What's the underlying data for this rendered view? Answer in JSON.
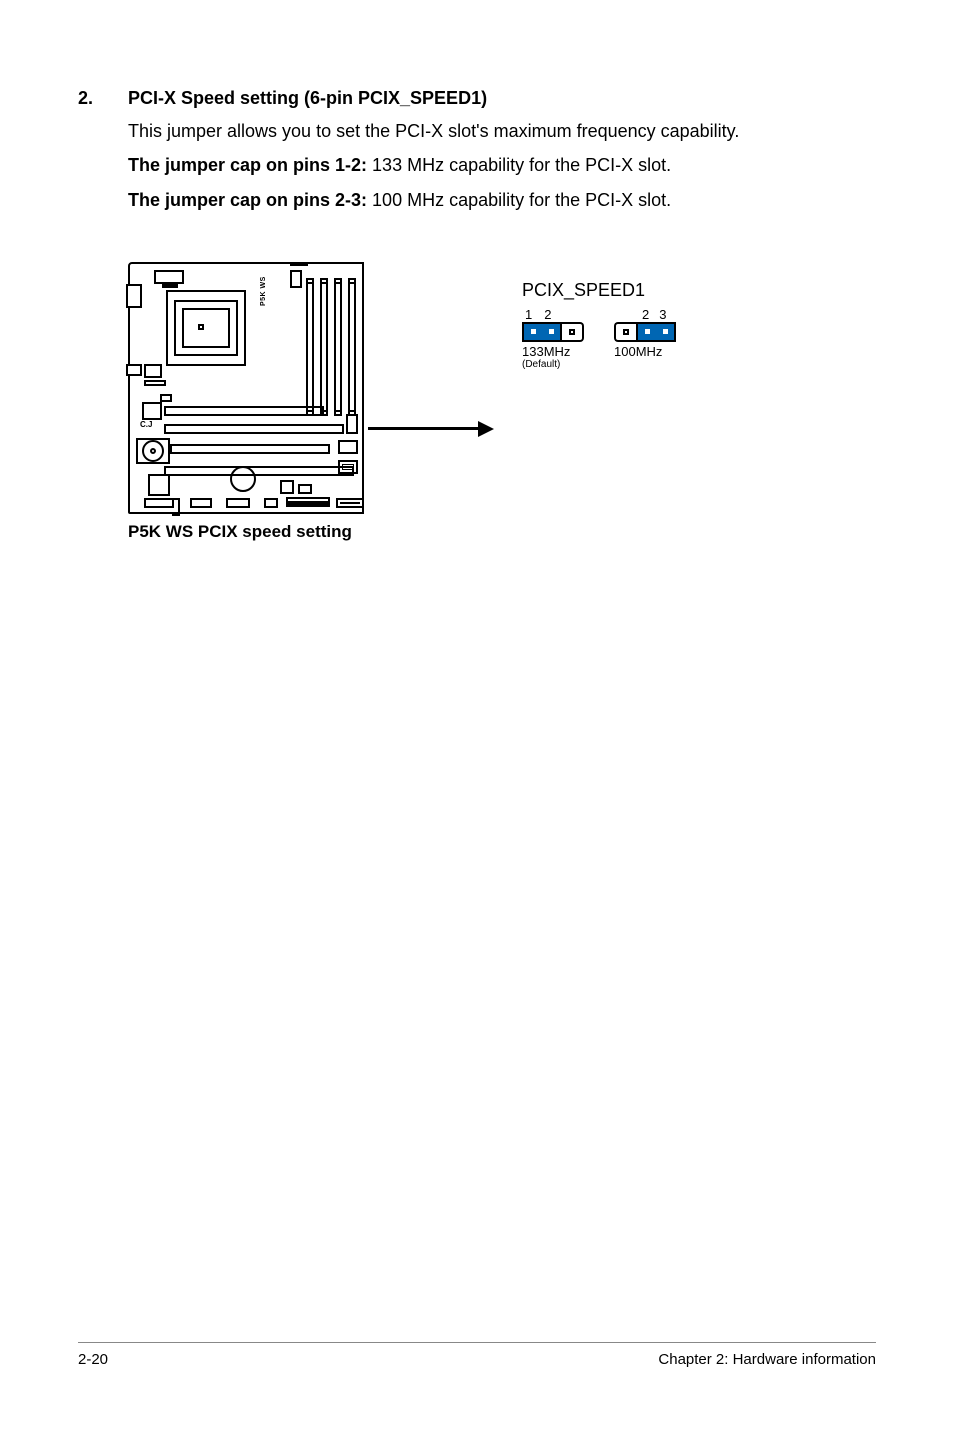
{
  "section": {
    "number": "2.",
    "title": "PCI-X Speed setting (6-pin PCIX_SPEED1)",
    "intro": "This jumper allows you to set the PCI-X slot's maximum frequency capability.",
    "line1_bold": "The jumper cap on pins 1-2:",
    "line1_rest": " 133 MHz capability for the PCI-X slot.",
    "line2_bold": "The jumper cap on pins 2-3:",
    "line2_rest": " 100 MHz capability for the PCI-X slot."
  },
  "diagram": {
    "vlabel": "P5K WS",
    "cj": "C.J",
    "caption": "P5K WS PCIX speed setting",
    "jumper_title": "PCIX_SPEED1",
    "left": {
      "n1": "1",
      "n2": "2",
      "label": "133MHz",
      "default": "(Default)"
    },
    "right": {
      "n1": "2",
      "n2": "3",
      "label": "100MHz"
    }
  },
  "footer": {
    "left": "2-20",
    "right": "Chapter 2: Hardware information"
  }
}
